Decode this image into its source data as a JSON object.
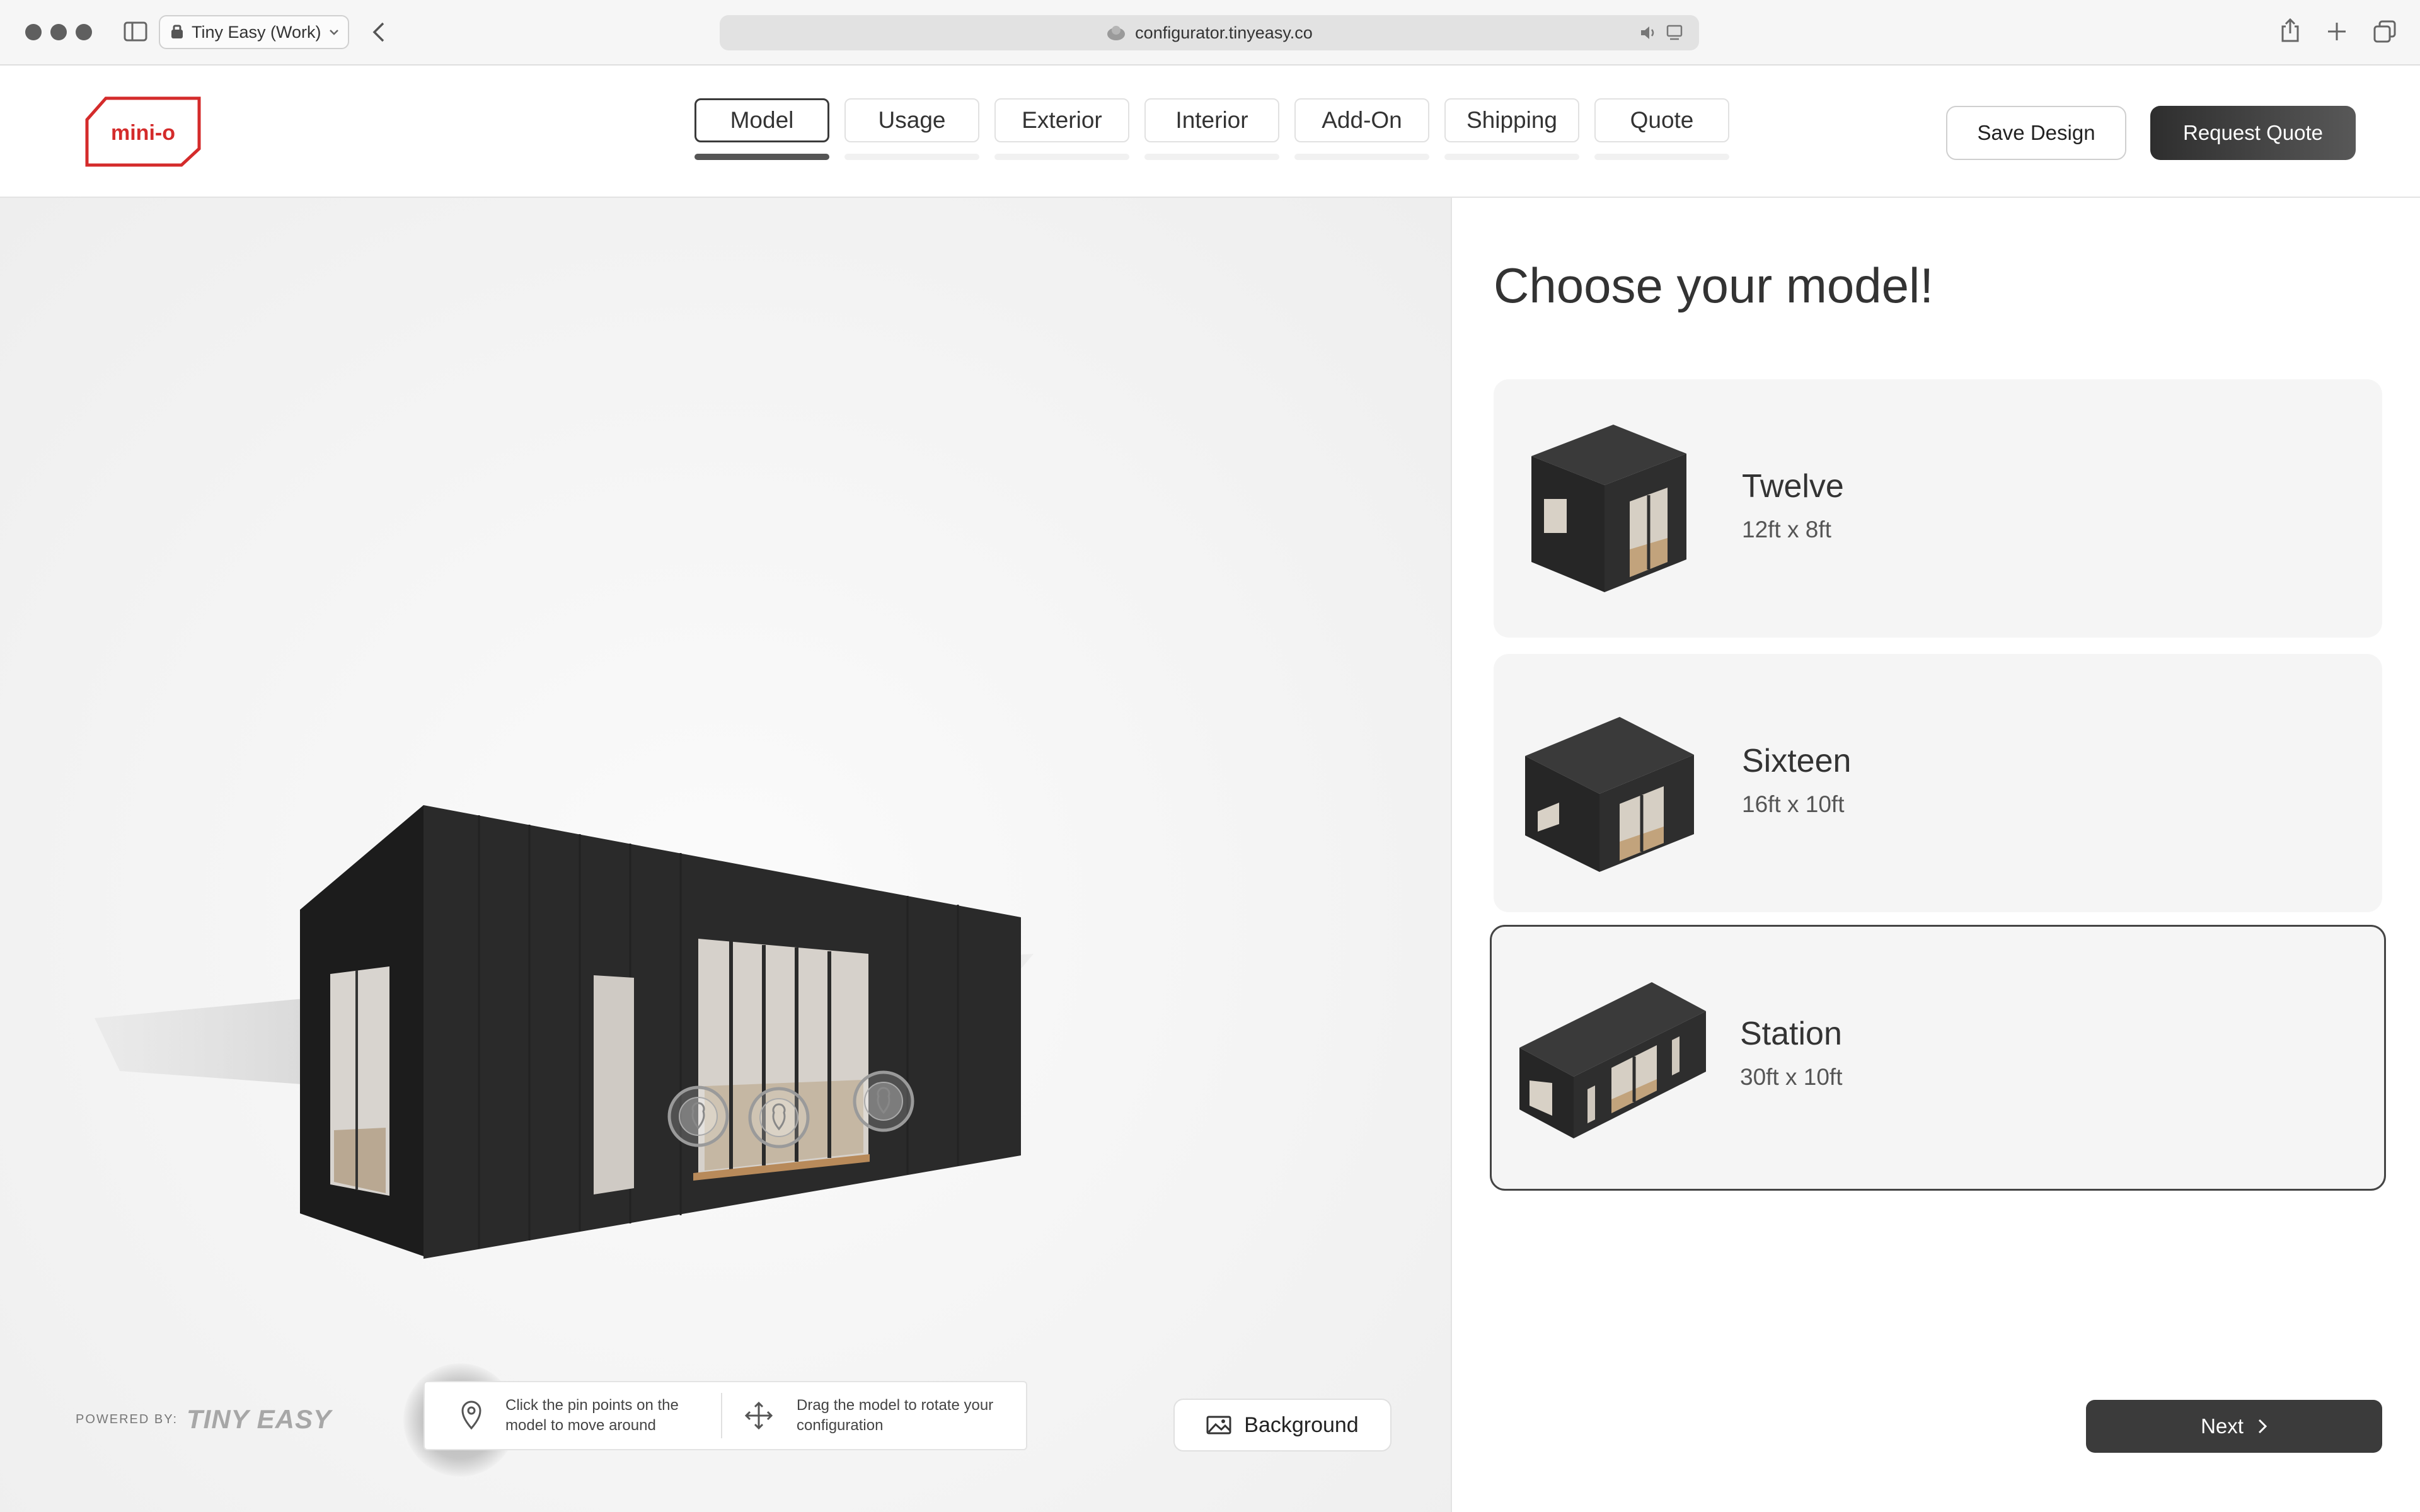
{
  "browser": {
    "profile_label": "Tiny Easy (Work)",
    "url": "configurator.tinyeasy.co",
    "icons": [
      "sidebar-icon",
      "profile-icon",
      "chevron-down-icon",
      "back-icon",
      "site-icon",
      "audio-icon",
      "reader-icon",
      "share-icon",
      "new-tab-icon",
      "tab-overview-icon"
    ]
  },
  "header": {
    "logo_text": "mini-o",
    "brand_color": "#d42b2b",
    "tabs": [
      {
        "label": "Model",
        "active": true
      },
      {
        "label": "Usage",
        "active": false
      },
      {
        "label": "Exterior",
        "active": false
      },
      {
        "label": "Interior",
        "active": false
      },
      {
        "label": "Add-On",
        "active": false
      },
      {
        "label": "Shipping",
        "active": false
      },
      {
        "label": "Quote",
        "active": false
      }
    ],
    "save_label": "Save Design",
    "quote_label": "Request Quote"
  },
  "viewer": {
    "powered_by_label": "POWERED BY:",
    "powered_by_logo": "TINY EASY",
    "hint_pin": "Click the pin points on the model to move around",
    "hint_drag": "Drag the model to rotate your configuration",
    "background_label": "Background",
    "pin_count": 3
  },
  "panel": {
    "title": "Choose your model!",
    "models": [
      {
        "name": "Twelve",
        "size": "12ft x 8ft",
        "selected": false
      },
      {
        "name": "Sixteen",
        "size": "16ft x 10ft",
        "selected": false
      },
      {
        "name": "Station",
        "size": "30ft x 10ft",
        "selected": true
      }
    ],
    "next_label": "Next"
  }
}
